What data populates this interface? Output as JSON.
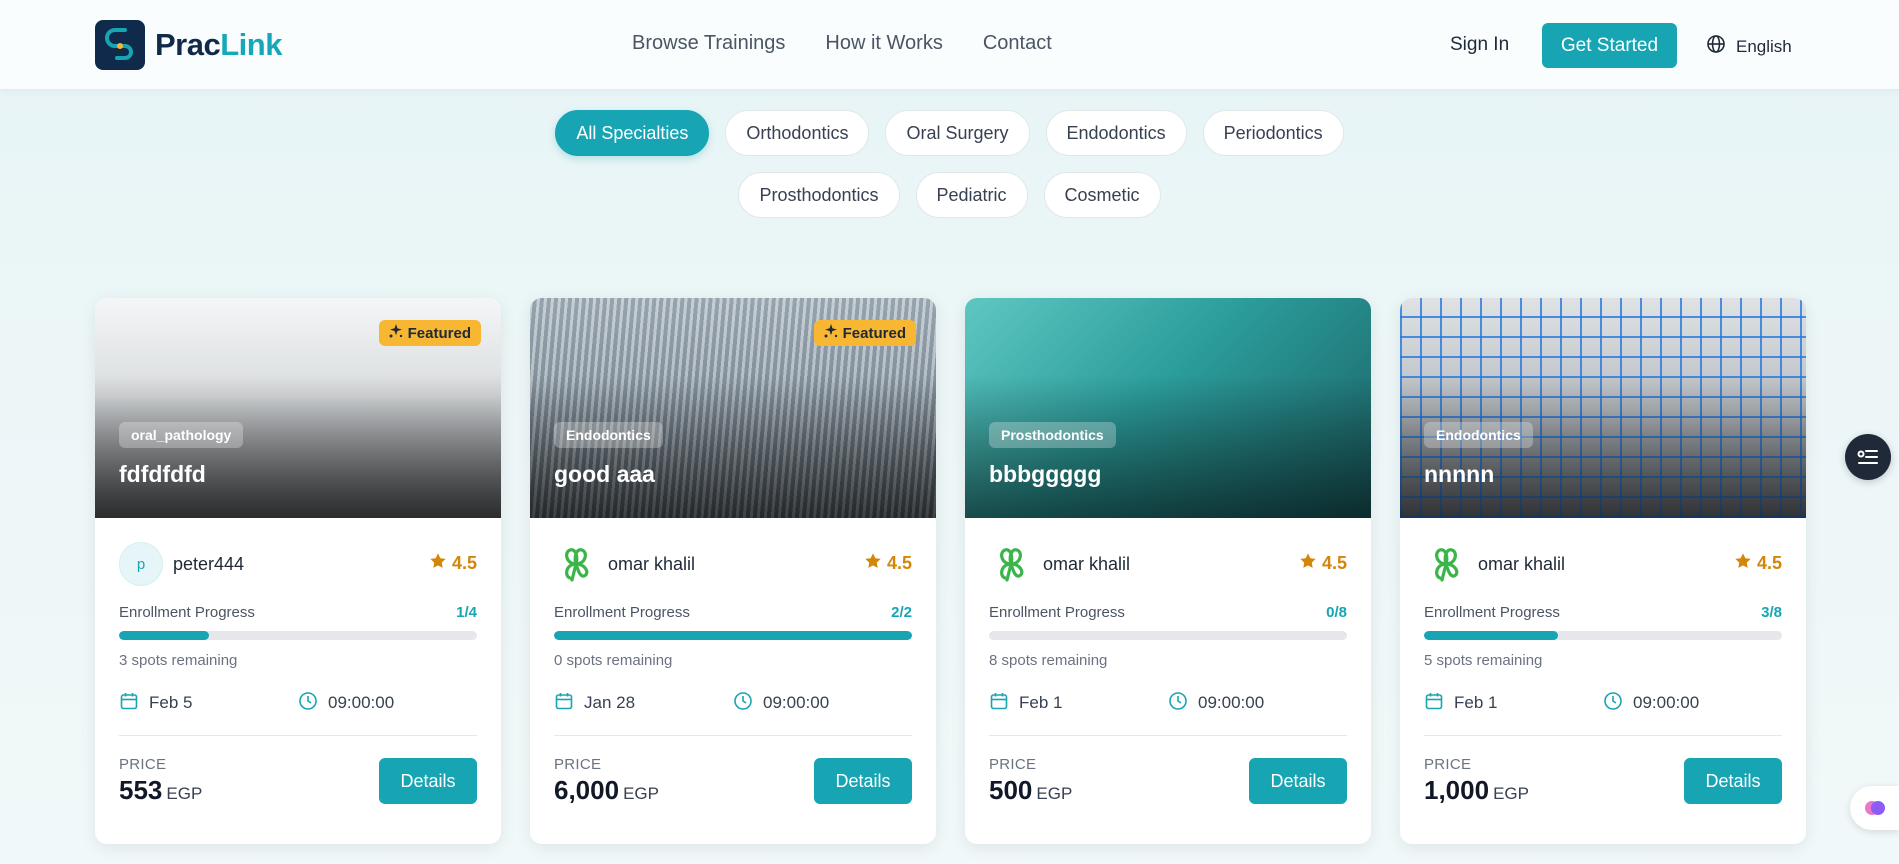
{
  "brand": {
    "name_part1": "Prac",
    "name_part2": "Link"
  },
  "nav": [
    {
      "label": "Browse Trainings"
    },
    {
      "label": "How it Works"
    },
    {
      "label": "Contact"
    }
  ],
  "header": {
    "sign_in": "Sign In",
    "get_started": "Get Started",
    "language": "English"
  },
  "filters": {
    "row1": [
      "All Specialties",
      "Orthodontics",
      "Oral Surgery",
      "Endodontics",
      "Periodontics"
    ],
    "row2": [
      "Prosthodontics",
      "Pediatric",
      "Cosmetic"
    ],
    "active": "All Specialties"
  },
  "labels": {
    "enrollment_progress": "Enrollment Progress",
    "price": "PRICE",
    "details": "Details",
    "featured": "Featured"
  },
  "cards": [
    {
      "specialty": "oral_pathology",
      "title": "fdfdfdfd",
      "featured": true,
      "author": "peter444",
      "avatar_initial": "p",
      "rating": "4.5",
      "progress_text": "1/4",
      "progress": 0.25,
      "spots": "3 spots remaining",
      "date": "Feb 5",
      "time": "09:00:00",
      "price": "553",
      "currency": "EGP"
    },
    {
      "specialty": "Endodontics",
      "title": "good aaa",
      "featured": true,
      "author": "omar khalil",
      "avatar_initial": "",
      "rating": "4.5",
      "progress_text": "2/2",
      "progress": 1.0,
      "spots": "0 spots remaining",
      "date": "Jan 28",
      "time": "09:00:00",
      "price": "6,000",
      "currency": "EGP"
    },
    {
      "specialty": "Prosthodontics",
      "title": "bbbggggg",
      "featured": false,
      "author": "omar khalil",
      "avatar_initial": "",
      "rating": "4.5",
      "progress_text": "0/8",
      "progress": 0.0,
      "spots": "8 spots remaining",
      "date": "Feb 1",
      "time": "09:00:00",
      "price": "500",
      "currency": "EGP"
    },
    {
      "specialty": "Endodontics",
      "title": "nnnnn",
      "featured": false,
      "author": "omar khalil",
      "avatar_initial": "",
      "rating": "4.5",
      "progress_text": "3/8",
      "progress": 0.375,
      "spots": "5 spots remaining",
      "date": "Feb 1",
      "time": "09:00:00",
      "price": "1,000",
      "currency": "EGP"
    }
  ],
  "colors": {
    "accent": "#17a5b3",
    "star": "#d4860b",
    "featured": "#f7b733",
    "navy": "#12294a"
  }
}
